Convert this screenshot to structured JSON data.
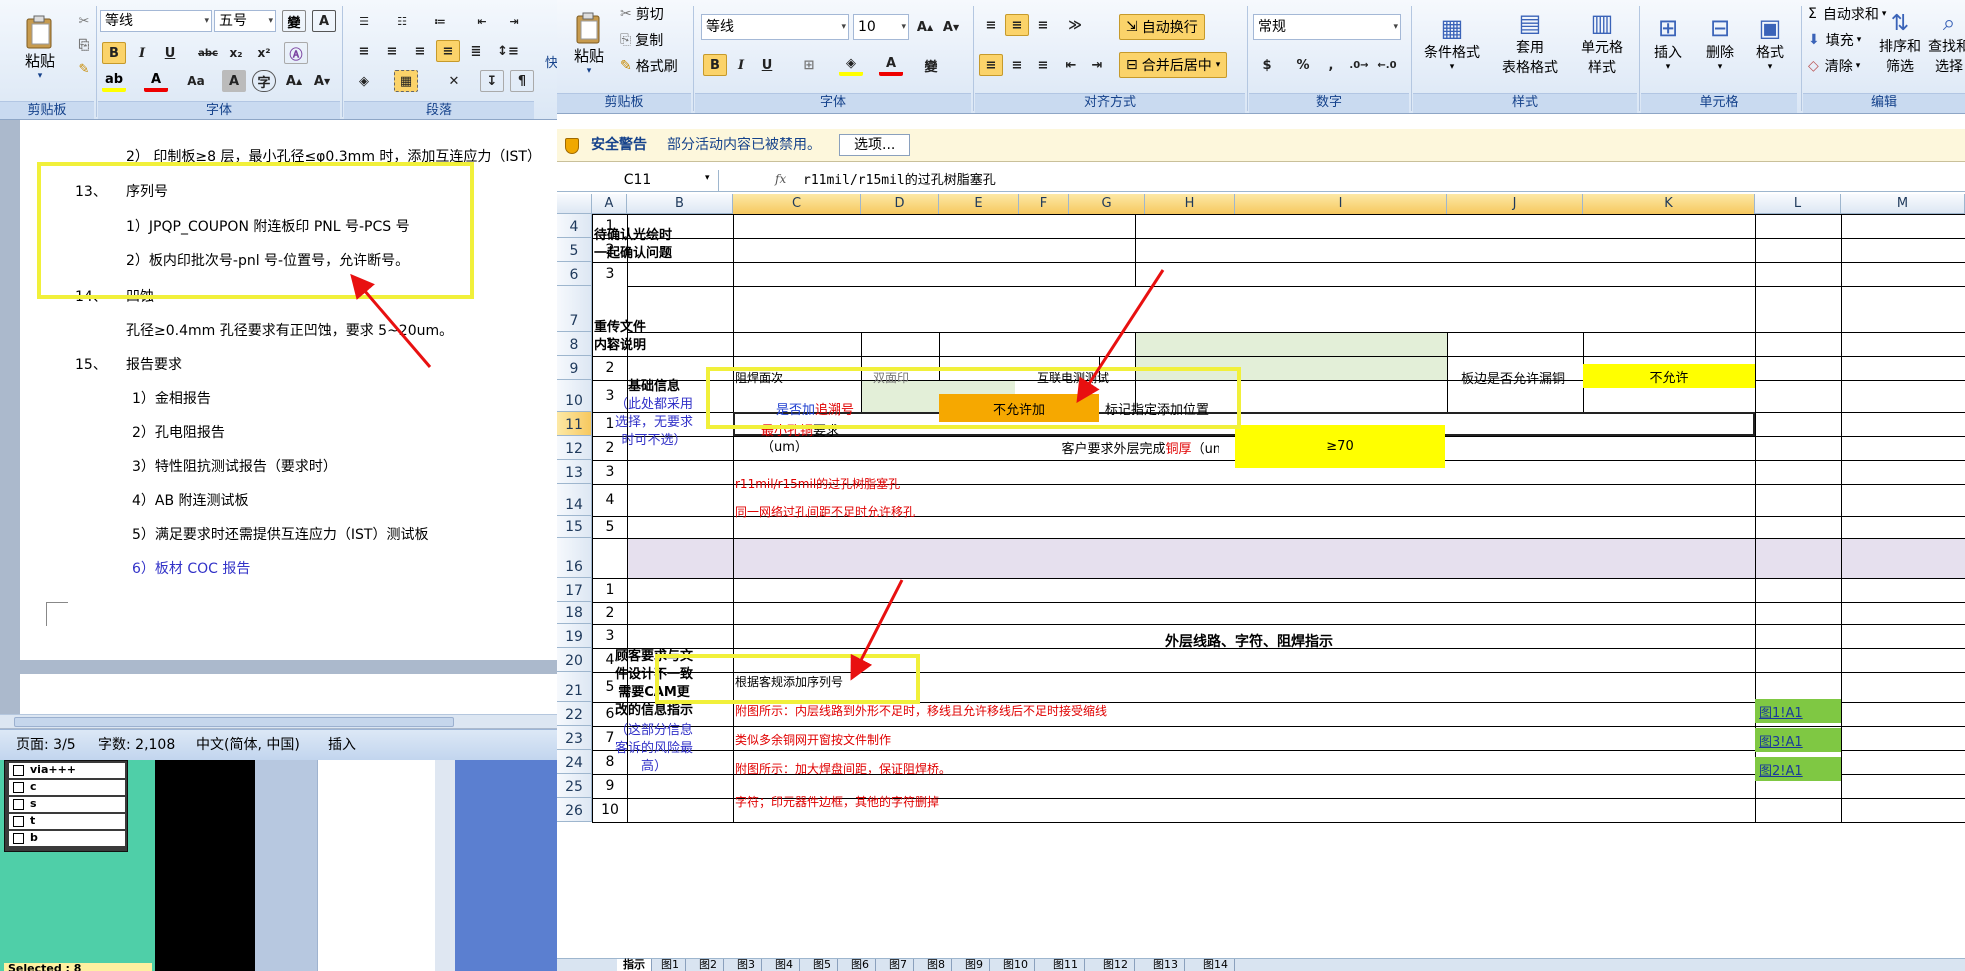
{
  "word": {
    "clipboard_group": "剪贴板",
    "font_group": "字体",
    "paragraph_group": "段落",
    "paste_label": "粘贴",
    "font_name": "等线",
    "font_size": "五号",
    "doc_lines": [
      "2） 印制板≥8 层，最小孔径≤φ0.3mm 时，添加互连应力（IST）",
      "13、",
      "序列号",
      "1）JPQP_COUPON 附连板印 PNL 号-PCS 号",
      "2）板内印批次号-pnl 号-位置号，允许断号。",
      "14、",
      "凹蚀",
      "孔径≥0.4mm 孔径要求有正凹蚀，要求 5~20um。",
      "15、",
      "报告要求",
      "1）金相报告",
      "2）孔电阻报告",
      "3）特性阻抗测试报告（要求时）",
      "4）AB 附连测试板",
      "5）满足要求时还需提供互连应力（IST）测试板",
      "6）板材 COC 报告"
    ],
    "status": {
      "page": "页面: 3/5",
      "words": "字数: 2,108",
      "lang": "中文(简体, 中国)",
      "mode": "插入"
    },
    "layers": [
      "via+++",
      "c",
      "s",
      "t",
      "b"
    ],
    "selected": "Selected : 8"
  },
  "excel": {
    "clipboard": {
      "paste": "粘贴",
      "cut": "剪切",
      "copy": "复制",
      "format_painter": "格式刷",
      "group": "剪贴板"
    },
    "font": {
      "name": "等线",
      "size": "10",
      "group": "字体"
    },
    "alignment": {
      "wrap": "自动换行",
      "merge": "合并后居中",
      "group": "对齐方式"
    },
    "number": {
      "format": "常规",
      "group": "数字"
    },
    "styles": {
      "conditional": "条件格式",
      "table": "套用",
      "table2": "表格格式",
      "cell_styles": "单元格",
      "cell_styles2": "样式",
      "group": "样式"
    },
    "cells": {
      "insert": "插入",
      "delete": "删除",
      "format": "格式",
      "group": "单元格"
    },
    "editing": {
      "autosum": "自动求和",
      "fill": "填充",
      "clear": "清除",
      "sort": "排序和",
      "sort2": "筛选",
      "find": "查找和",
      "find2": "选择",
      "group": "编辑"
    },
    "security": {
      "title": "安全警告",
      "message": "部分活动内容已被禁用。",
      "options": "选项..."
    },
    "name_box": "C11",
    "fx": "fx",
    "formula": "r11mil/r15mil的过孔树脂塞孔",
    "columns": [
      "A",
      "B",
      "C",
      "D",
      "E",
      "F",
      "G",
      "H",
      "I",
      "J",
      "K",
      "L",
      "M"
    ],
    "rows": [
      "4",
      "5",
      "6",
      "7",
      "8",
      "9",
      "10",
      "11",
      "12",
      "13",
      "14",
      "15",
      "16",
      "17",
      "18",
      "19",
      "20",
      "21",
      "22",
      "23",
      "24",
      "25",
      "26"
    ],
    "cells_text": {
      "a_pending": "待确认光绘时\n一起确认问题",
      "a_reupload": "重传文件\n内容说明",
      "a_basic": "基础信息",
      "a_basic_note": "（此处都采用\n选择，无要求\n时可不选）",
      "a_customer": "顾客要求与文\n件设计不一致\n需要CAM更\n改的信息指示",
      "a_customer_note": "（这部分信息\n客诉的风险最\n高）",
      "r8_c": "阻焊面次",
      "r8_d": "双面印",
      "r8_f": "互联电测测试",
      "r8_j": "板边是否允许漏铜",
      "r8_k": "不允许",
      "r9_c_pre": "是否加",
      "r9_c_red": "追溯号",
      "r9_e": "不允许加",
      "r9_g": "标记指定添加位置",
      "r10_c_red": "最小孔铜",
      "r10_c_post": "要求\n（um）",
      "r10_f_pre": "客户要求外层完成",
      "r10_f_red": "铜厚",
      "r10_f_post": "（um）",
      "r10_i": "≥70",
      "r11": "r11mil/r15mil的过孔树脂塞孔",
      "r12": "同一网络过孔间距不足时允许移孔",
      "r16": "外层线路、字符、阻焊指示",
      "r17": "根据客规添加序列号",
      "r18": "附图所示：内层线路到外形不足时，移线且允许移线后不足时接受缩线",
      "r19": "类似多余铜网开窗按文件制作",
      "r20": "附图所示：加大焊盘间距，保证阻焊桥。",
      "r21": "字符；印元器件边框，其他的字符删掉",
      "link18": "图1!A1",
      "link19": "图3!A1",
      "link20": "图2!A1"
    },
    "seq": [
      "1",
      "2",
      "3",
      "1",
      "2",
      "3",
      "1",
      "2",
      "3",
      "4",
      "5",
      "1",
      "2",
      "3",
      "4",
      "5",
      "6",
      "7",
      "8",
      "9",
      "10"
    ],
    "sheet_tabs": [
      "指示",
      "图1",
      "图2",
      "图3",
      "图4",
      "图5",
      "图6",
      "图7",
      "图8",
      "图9",
      "图10",
      "图11",
      "图12",
      "图13",
      "图14"
    ]
  }
}
